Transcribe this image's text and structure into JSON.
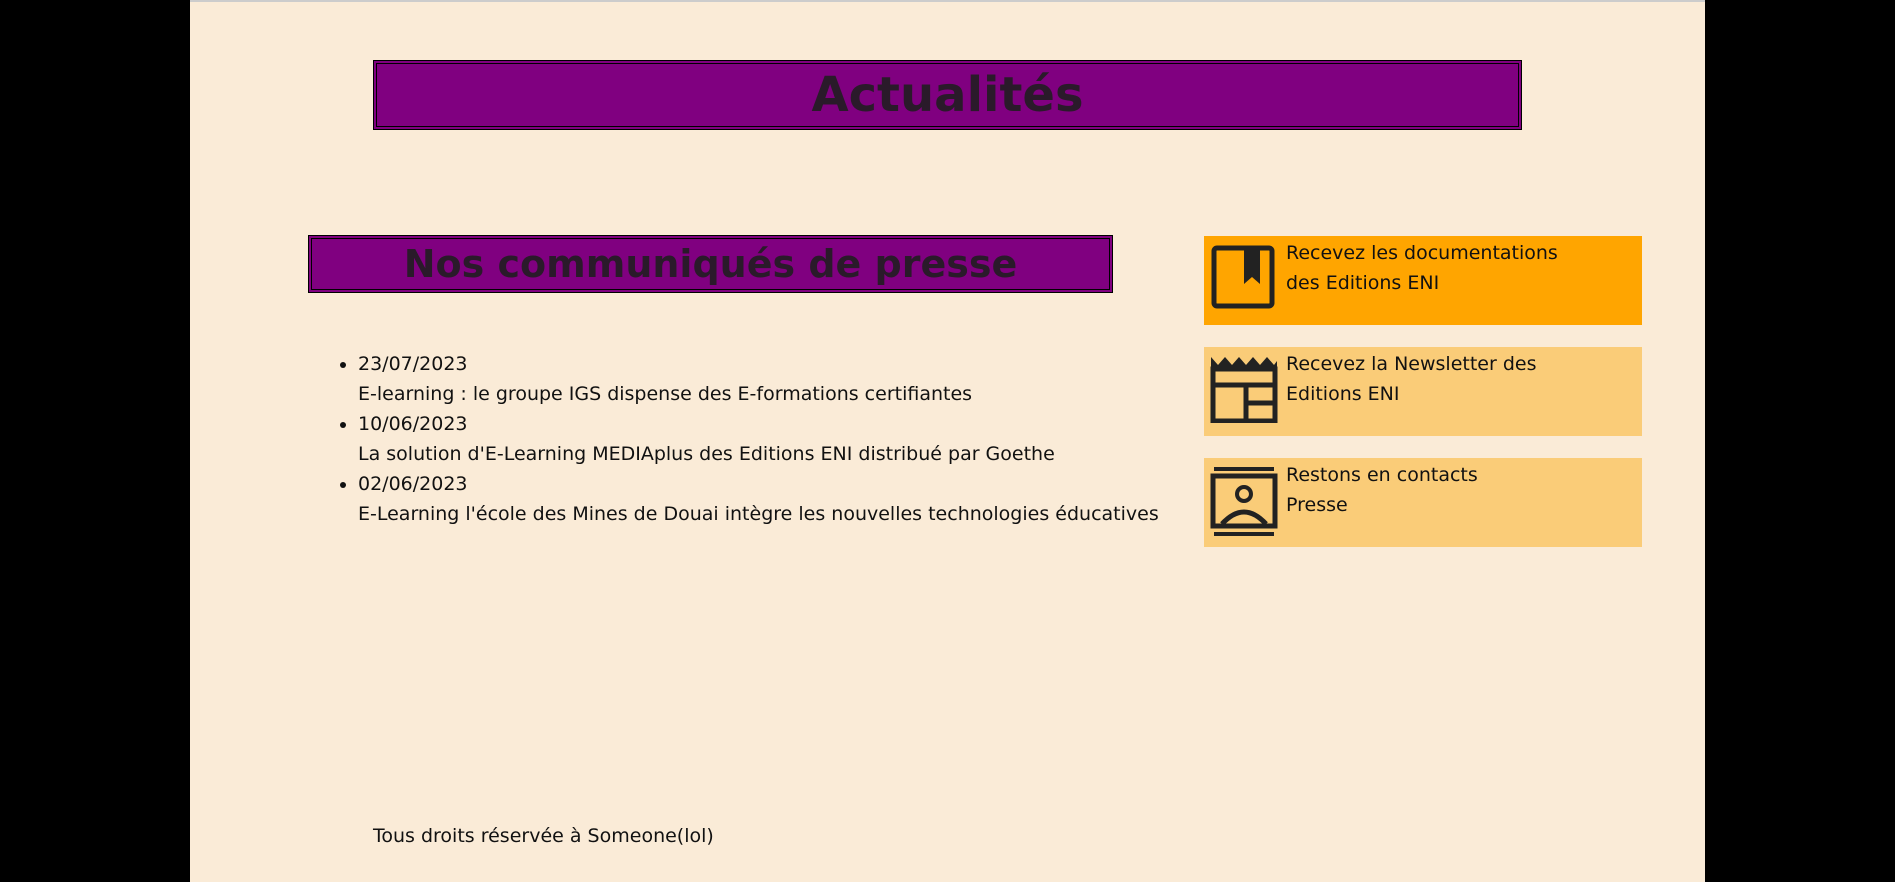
{
  "header": {
    "title": "Actualités"
  },
  "press": {
    "title": "Nos communiqués de presse",
    "items": [
      {
        "date": "23/07/2023",
        "headline": "E-learning : le groupe IGS dispense des E-formations certifiantes"
      },
      {
        "date": "10/06/2023",
        "headline": "La solution d'E-Learning MEDIAplus des Editions ENI distribué par Goethe"
      },
      {
        "date": "02/06/2023",
        "headline": "E-Learning l'école des Mines de Douai intègre les nouvelles technologies éducatives"
      }
    ]
  },
  "sidebar": {
    "cards": [
      {
        "line1": "Recevez les documentations",
        "line2": "des Editions ENI",
        "icon": "bookmark-icon",
        "color": "#ffa500"
      },
      {
        "line1": "Recevez la Newsletter des",
        "line2": "Editions ENI",
        "icon": "newspaper-icon",
        "color": "#facc78"
      },
      {
        "line1": "Restons en contacts",
        "line2": "Presse",
        "icon": "contact-icon",
        "color": "#facc78"
      }
    ]
  },
  "footer": {
    "text": "Tous droits réservée à Someone(lol)"
  },
  "colors": {
    "background": "#000000",
    "page": "#faebd7",
    "banner": "#800080"
  }
}
